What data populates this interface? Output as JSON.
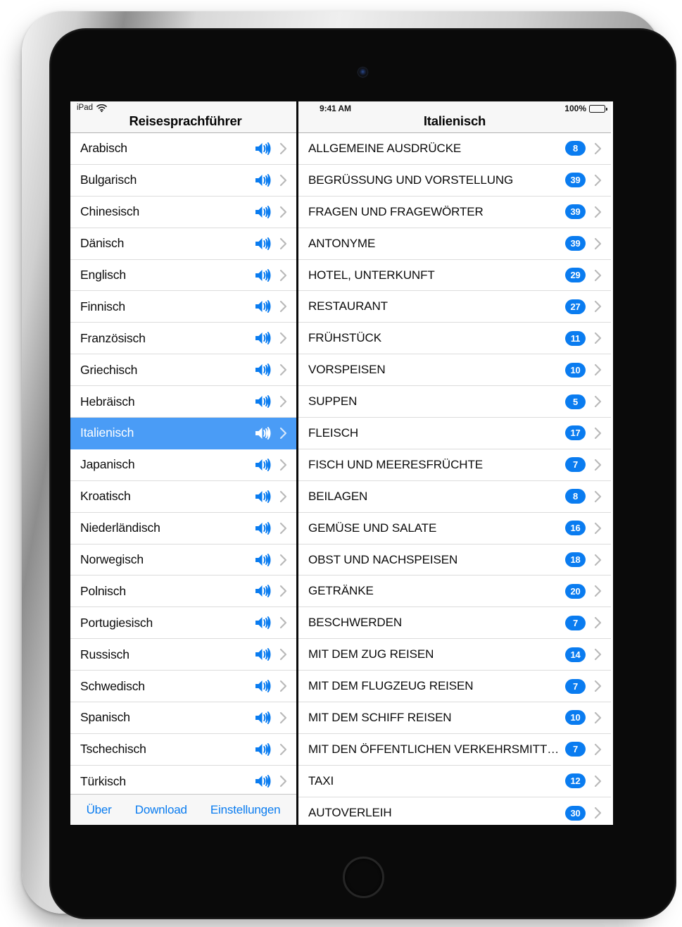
{
  "device": {
    "type": "ipad",
    "camera_icon": "camera-icon",
    "home_button_icon": "home-button-icon"
  },
  "status_bar": {
    "carrier": "iPad",
    "wifi_icon": "wifi-icon",
    "time": "9:41 AM",
    "battery_percent": "100%",
    "battery_icon": "battery-full-icon"
  },
  "left_panel": {
    "title": "Reisesprachführer",
    "speaker_icon": "speaker-icon",
    "chevron_icon": "chevron-right-icon",
    "selected_index": 9,
    "languages": [
      "Arabisch",
      "Bulgarisch",
      "Chinesisch",
      "Dänisch",
      "Englisch",
      "Finnisch",
      "Französisch",
      "Griechisch",
      "Hebräisch",
      "Italienisch",
      "Japanisch",
      "Kroatisch",
      "Niederländisch",
      "Norwegisch",
      "Polnisch",
      "Portugiesisch",
      "Russisch",
      "Schwedisch",
      "Spanisch",
      "Tschechisch",
      "Türkisch"
    ],
    "toolbar": {
      "about_label": "Über",
      "download_label": "Download",
      "settings_label": "Einstellungen"
    }
  },
  "right_panel": {
    "title": "Italienisch",
    "chevron_icon": "chevron-right-icon",
    "categories": [
      {
        "label": "ALLGEMEINE AUSDRÜCKE",
        "count": "8"
      },
      {
        "label": "BEGRÜSSUNG UND VORSTELLUNG",
        "count": "39"
      },
      {
        "label": "FRAGEN UND FRAGEWÖRTER",
        "count": "39"
      },
      {
        "label": "ANTONYME",
        "count": "39"
      },
      {
        "label": "HOTEL, UNTERKUNFT",
        "count": "29"
      },
      {
        "label": "RESTAURANT",
        "count": "27"
      },
      {
        "label": "FRÜHSTÜCK",
        "count": "11"
      },
      {
        "label": "VORSPEISEN",
        "count": "10"
      },
      {
        "label": "SUPPEN",
        "count": "5"
      },
      {
        "label": "FLEISCH",
        "count": "17"
      },
      {
        "label": "FISCH UND MEERESFRÜCHTE",
        "count": "7"
      },
      {
        "label": "BEILAGEN",
        "count": "8"
      },
      {
        "label": "GEMÜSE UND SALATE",
        "count": "16"
      },
      {
        "label": "OBST UND NACHSPEISEN",
        "count": "18"
      },
      {
        "label": "GETRÄNKE",
        "count": "20"
      },
      {
        "label": "BESCHWERDEN",
        "count": "7"
      },
      {
        "label": "MIT DEM ZUG REISEN",
        "count": "14"
      },
      {
        "label": "MIT DEM FLUGZEUG REISEN",
        "count": "7"
      },
      {
        "label": "MIT DEM SCHIFF REISEN",
        "count": "10"
      },
      {
        "label": "MIT DEN ÖFFENTLICHEN VERKEHRSMITTE…",
        "count": "7"
      },
      {
        "label": "TAXI",
        "count": "12"
      },
      {
        "label": "AUTOVERLEIH",
        "count": "30"
      }
    ]
  },
  "colors": {
    "accent_blue": "#0a7cf0",
    "selection_blue": "#4a9cf6",
    "navbar_bg": "#f7f7f7",
    "separator": "#dcdcdc"
  }
}
